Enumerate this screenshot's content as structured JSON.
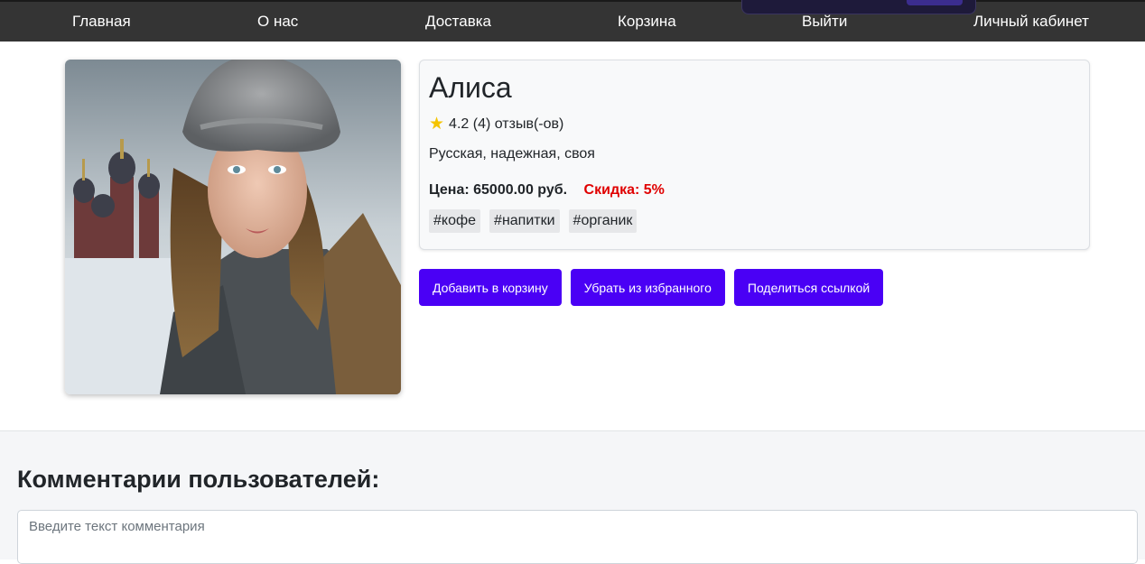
{
  "nav": {
    "items": [
      {
        "label": "Главная"
      },
      {
        "label": "О нас"
      },
      {
        "label": "Доставка"
      },
      {
        "label": "Корзина"
      },
      {
        "label": "Выйти"
      },
      {
        "label": "Личный кабинет"
      }
    ]
  },
  "product": {
    "name": "Алиса",
    "rating_text": "4.2 (4) отзыв(-ов)",
    "description": "Русская, надежная, своя",
    "price": "Цена: 65000.00 руб.",
    "discount": "Скидка: 5%",
    "tags": [
      "#кофе",
      "#напитки",
      "#органик"
    ]
  },
  "actions": {
    "add_to_cart": "Добавить в корзину",
    "remove_favorite": "Убрать из избранного",
    "share_link": "Поделиться ссылкой"
  },
  "comments": {
    "title": "Комментарии пользователей:",
    "placeholder": "Введите текст комментария"
  },
  "colors": {
    "accent": "#4a00f5",
    "navbar": "#343434",
    "discount": "#e00000",
    "star": "#f5c400"
  }
}
